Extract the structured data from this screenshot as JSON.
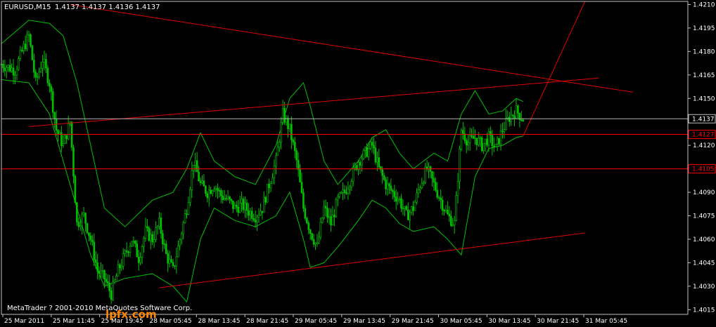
{
  "header": {
    "symbol_label": "EURUSD,M15",
    "ohlc_text": "1.4137 1.4137 1.4136 1.4137"
  },
  "copyright": "MetaTrader ? 2001-2010 MetaQuotes Software Corp.",
  "watermark": "lpfx.com",
  "colors": {
    "background": "#000000",
    "candles": "#00c000",
    "bands": "#00c000",
    "trendlines": "#e00000",
    "levels": "#ff0000",
    "bid_line": "#b0b0b0",
    "axis_text": "#ffffff",
    "label_text": "#ff0000"
  },
  "chart_data": {
    "type": "candlestick",
    "symbol": "EURUSD",
    "timeframe": "M15",
    "y_ticks": [
      "1.4210",
      "1.4195",
      "1.4180",
      "1.4165",
      "1.4150",
      "1.4120",
      "1.4090",
      "1.4075",
      "1.4060",
      "1.4045",
      "1.4030",
      "1.4015"
    ],
    "x_ticks": [
      "25 Mar 2011",
      "25 Mar 11:45",
      "25 Mar 19:45",
      "28 Mar 05:45",
      "28 Mar 13:45",
      "28 Mar 21:45",
      "29 Mar 05:45",
      "29 Mar 13:45",
      "29 Mar 21:45",
      "30 Mar 05:45",
      "30 Mar 13:45",
      "30 Mar 21:45",
      "31 Mar 05:45"
    ],
    "ylim": [
      1.4012,
      1.4212
    ],
    "current_price": {
      "value": 1.4137,
      "label": "1.4137"
    },
    "horizontal_levels": [
      {
        "value": 1.4127,
        "label": "1.4127"
      },
      {
        "value": 1.4105,
        "label": "1.4105"
      }
    ],
    "trendlines_bar_price": [
      {
        "name": "upper-descending",
        "x1": 0.1,
        "y1": 1.421,
        "x2": 0.92,
        "y2": 1.4154
      },
      {
        "name": "middle-ascending",
        "x1": 0.04,
        "y1": 1.4132,
        "x2": 0.87,
        "y2": 1.4163
      },
      {
        "name": "lower-ascending",
        "x1": 0.23,
        "y1": 1.4029,
        "x2": 0.85,
        "y2": 1.4064
      },
      {
        "name": "steep-breakout",
        "x1": 0.76,
        "y1": 1.4126,
        "x2": 0.85,
        "y2": 1.4212
      }
    ],
    "close_path": [
      [
        0.0,
        1.4172
      ],
      [
        0.02,
        1.4168
      ],
      [
        0.03,
        1.418
      ],
      [
        0.04,
        1.419
      ],
      [
        0.05,
        1.416
      ],
      [
        0.06,
        1.4175
      ],
      [
        0.07,
        1.416
      ],
      [
        0.08,
        1.413
      ],
      [
        0.09,
        1.412
      ],
      [
        0.1,
        1.4135
      ],
      [
        0.11,
        1.407
      ],
      [
        0.12,
        1.4075
      ],
      [
        0.13,
        1.406
      ],
      [
        0.14,
        1.404
      ],
      [
        0.15,
        1.4035
      ],
      [
        0.16,
        1.4025
      ],
      [
        0.17,
        1.404
      ],
      [
        0.18,
        1.405
      ],
      [
        0.19,
        1.406
      ],
      [
        0.2,
        1.4048
      ],
      [
        0.21,
        1.4065
      ],
      [
        0.22,
        1.406
      ],
      [
        0.23,
        1.407
      ],
      [
        0.24,
        1.405
      ],
      [
        0.25,
        1.404
      ],
      [
        0.26,
        1.406
      ],
      [
        0.27,
        1.408
      ],
      [
        0.28,
        1.411
      ],
      [
        0.29,
        1.4095
      ],
      [
        0.3,
        1.409
      ],
      [
        0.31,
        1.4095
      ],
      [
        0.32,
        1.4088
      ],
      [
        0.33,
        1.4085
      ],
      [
        0.34,
        1.408
      ],
      [
        0.35,
        1.4082
      ],
      [
        0.36,
        1.4078
      ],
      [
        0.37,
        1.4075
      ],
      [
        0.38,
        1.408
      ],
      [
        0.39,
        1.4095
      ],
      [
        0.4,
        1.411
      ],
      [
        0.41,
        1.414
      ],
      [
        0.42,
        1.413
      ],
      [
        0.43,
        1.411
      ],
      [
        0.44,
        1.408
      ],
      [
        0.45,
        1.4065
      ],
      [
        0.46,
        1.4055
      ],
      [
        0.47,
        1.408
      ],
      [
        0.48,
        1.407
      ],
      [
        0.49,
        1.4085
      ],
      [
        0.5,
        1.409
      ],
      [
        0.51,
        1.41
      ],
      [
        0.52,
        1.411
      ],
      [
        0.53,
        1.4115
      ],
      [
        0.54,
        1.412
      ],
      [
        0.55,
        1.4105
      ],
      [
        0.56,
        1.4095
      ],
      [
        0.57,
        1.409
      ],
      [
        0.58,
        1.4085
      ],
      [
        0.59,
        1.4075
      ],
      [
        0.6,
        1.408
      ],
      [
        0.61,
        1.4095
      ],
      [
        0.62,
        1.4105
      ],
      [
        0.63,
        1.4095
      ],
      [
        0.64,
        1.4085
      ],
      [
        0.65,
        1.4075
      ],
      [
        0.66,
        1.407
      ],
      [
        0.67,
        1.413
      ],
      [
        0.68,
        1.4122
      ],
      [
        0.69,
        1.4125
      ],
      [
        0.7,
        1.412
      ],
      [
        0.71,
        1.4125
      ],
      [
        0.72,
        1.4118
      ],
      [
        0.73,
        1.413
      ],
      [
        0.74,
        1.4138
      ],
      [
        0.75,
        1.4142
      ],
      [
        0.76,
        1.4137
      ]
    ],
    "upper_band": [
      [
        0.0,
        1.4185
      ],
      [
        0.04,
        1.42
      ],
      [
        0.07,
        1.4198
      ],
      [
        0.09,
        1.419
      ],
      [
        0.11,
        1.416
      ],
      [
        0.13,
        1.412
      ],
      [
        0.15,
        1.408
      ],
      [
        0.18,
        1.4068
      ],
      [
        0.22,
        1.4085
      ],
      [
        0.25,
        1.409
      ],
      [
        0.27,
        1.4105
      ],
      [
        0.29,
        1.4128
      ],
      [
        0.31,
        1.411
      ],
      [
        0.34,
        1.41
      ],
      [
        0.37,
        1.4095
      ],
      [
        0.4,
        1.412
      ],
      [
        0.42,
        1.415
      ],
      [
        0.44,
        1.416
      ],
      [
        0.45,
        1.4145
      ],
      [
        0.47,
        1.411
      ],
      [
        0.49,
        1.4095
      ],
      [
        0.52,
        1.411
      ],
      [
        0.54,
        1.4125
      ],
      [
        0.56,
        1.413
      ],
      [
        0.58,
        1.4115
      ],
      [
        0.6,
        1.4105
      ],
      [
        0.63,
        1.4115
      ],
      [
        0.65,
        1.411
      ],
      [
        0.67,
        1.414
      ],
      [
        0.69,
        1.4155
      ],
      [
        0.71,
        1.414
      ],
      [
        0.73,
        1.4142
      ],
      [
        0.75,
        1.415
      ],
      [
        0.76,
        1.4148
      ]
    ],
    "lower_band": [
      [
        0.0,
        1.4162
      ],
      [
        0.04,
        1.416
      ],
      [
        0.07,
        1.414
      ],
      [
        0.09,
        1.411
      ],
      [
        0.11,
        1.408
      ],
      [
        0.13,
        1.405
      ],
      [
        0.15,
        1.403
      ],
      [
        0.18,
        1.4035
      ],
      [
        0.22,
        1.4038
      ],
      [
        0.25,
        1.403
      ],
      [
        0.27,
        1.402
      ],
      [
        0.29,
        1.406
      ],
      [
        0.31,
        1.408
      ],
      [
        0.34,
        1.4072
      ],
      [
        0.37,
        1.4068
      ],
      [
        0.4,
        1.4075
      ],
      [
        0.42,
        1.409
      ],
      [
        0.44,
        1.406
      ],
      [
        0.45,
        1.4042
      ],
      [
        0.47,
        1.4045
      ],
      [
        0.49,
        1.4055
      ],
      [
        0.52,
        1.4072
      ],
      [
        0.54,
        1.4085
      ],
      [
        0.56,
        1.408
      ],
      [
        0.58,
        1.407
      ],
      [
        0.6,
        1.4065
      ],
      [
        0.63,
        1.4068
      ],
      [
        0.65,
        1.406
      ],
      [
        0.67,
        1.405
      ],
      [
        0.69,
        1.41
      ],
      [
        0.71,
        1.4118
      ],
      [
        0.73,
        1.412
      ],
      [
        0.75,
        1.4125
      ],
      [
        0.76,
        1.4126
      ]
    ]
  }
}
